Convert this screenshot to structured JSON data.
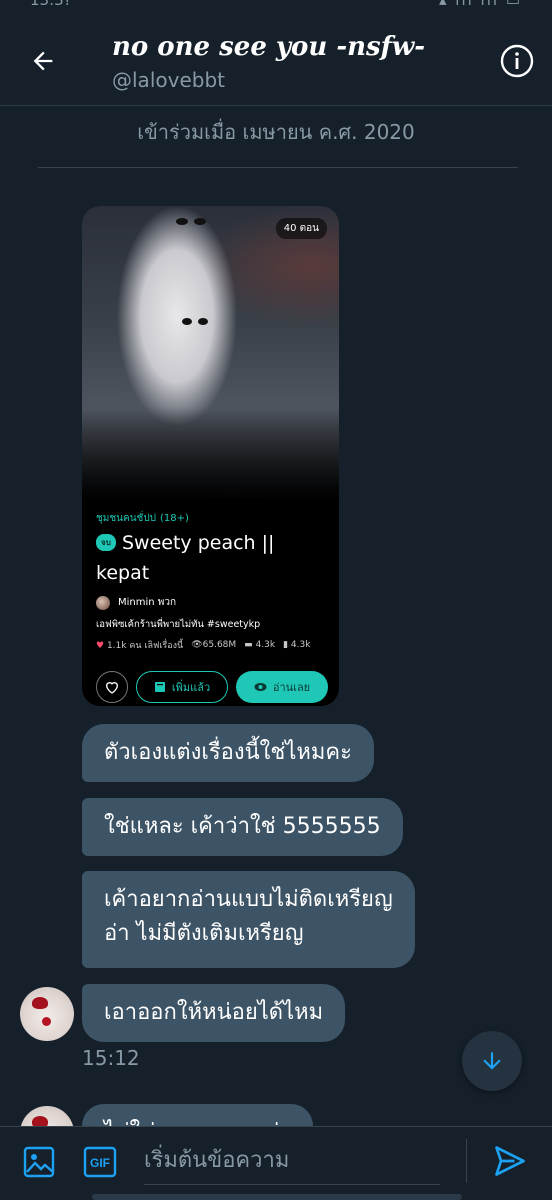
{
  "colors": {
    "background": "#15202b",
    "bubble": "#3d5466",
    "accent": "#1da1f2",
    "secondary_text": "#8899a6",
    "card_accent": "#1fc7b6"
  },
  "status_bar": {
    "time": "13:3?",
    "right": "▴ ıll ıll ▭"
  },
  "header": {
    "title": "no one see you -nsfw-",
    "handle": "@lalovebbt",
    "back_icon": "arrow-left-icon",
    "info_icon": "info-icon"
  },
  "conversation": {
    "joined_text": "เข้าร่วมเมื่อ เมษายน ค.ศ. 2020"
  },
  "shared_card": {
    "episodes": "40 ตอน",
    "category": "ชุมชนคนชั่ปป",
    "rating": "(18+)",
    "complete_tag": "จบ",
    "title": "Sweety peach || kepat",
    "author": "Minmin พวก",
    "description": "เอฟพิซเค้กร้านพี่พายไม่ทัน #sweetykp",
    "stats": {
      "likes": "1.1k คน เลิฟเรื่องนี้",
      "views": "65.68M",
      "comments": "4.3k",
      "lists": "4.3k"
    },
    "added_label": "เพิ่มแล้ว",
    "read_label": "อ่านเลย"
  },
  "messages": [
    {
      "text": "ตัวเองแต่งเรื่องนี้ใช่ไหมคะ"
    },
    {
      "text": "ใช่แหละ เค้าว่าใช่ 5555555"
    },
    {
      "text": "เค้าอยากอ่านแบบไม่ติดเหรียญ\nอ่า ไม่มีตังเติมเหรียญ"
    },
    {
      "text": "เอาออกให้หน่อยได้ไหม"
    },
    {
      "text": "ไม่ใช่แบบนนนน ค่ะ"
    }
  ],
  "message_time": "15:12",
  "composer": {
    "placeholder": "เริ่มต้นข้อความ",
    "image_icon": "image-icon",
    "gif_label": "GIF",
    "send_icon": "send-icon"
  }
}
